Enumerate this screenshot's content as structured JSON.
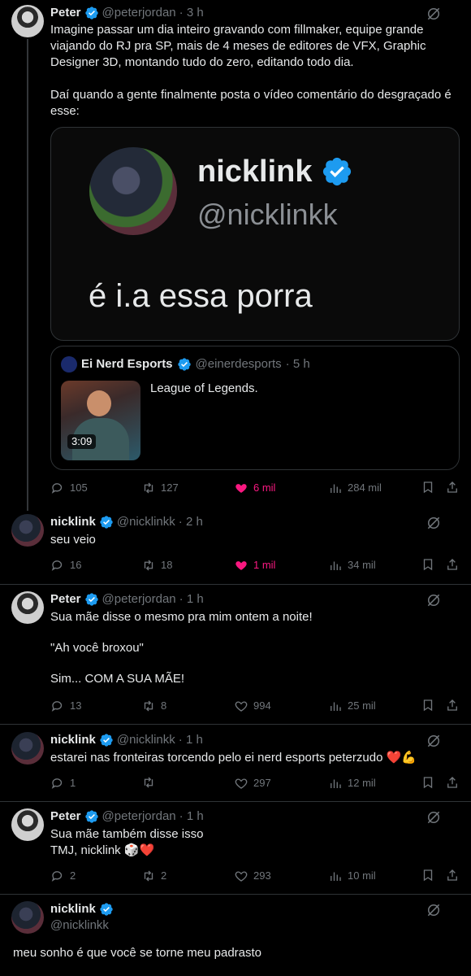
{
  "main_tweet": {
    "name": "Peter",
    "handle": "@peterjordan",
    "time": "· 3 h",
    "text": "Imagine passar um dia inteiro gravando com fillmaker, equipe grande viajando do RJ pra SP, mais de 4 meses de editores de VFX, Graphic Designer 3D, montando tudo do zero, editando todo dia.\n\nDaí quando a gente finalmente posta o vídeo comentário do desgraçado é esse:",
    "media": {
      "name": "nicklink",
      "handle": "@nicklinkk",
      "caption": "é i.a essa porra"
    },
    "quote": {
      "name": "Ei Nerd Esports",
      "handle": "@einerdesports",
      "time": "· 5 h",
      "text": "League of Legends.",
      "duration": "3:09"
    },
    "stats": {
      "replies": "105",
      "retweets": "127",
      "likes": "6 mil",
      "views": "284 mil"
    }
  },
  "replies": [
    {
      "name": "nicklink",
      "handle": "@nicklinkk",
      "time": "· 2 h",
      "text": "seu veio",
      "stats": {
        "replies": "16",
        "retweets": "18",
        "likes": "1 mil",
        "views": "34 mil"
      }
    },
    {
      "name": "Peter",
      "handle": "@peterjordan",
      "time": "· 1 h",
      "text": "Sua mãe disse o mesmo pra mim ontem a noite!\n\n\"Ah você broxou\"\n\nSim... COM A SUA MÃE!",
      "stats": {
        "replies": "13",
        "retweets": "8",
        "likes": "994",
        "views": "25 mil"
      }
    },
    {
      "name": "nicklink",
      "handle": "@nicklinkk",
      "time": "· 1 h",
      "text": "estarei nas fronteiras torcendo pelo ei nerd esports peterzudo ❤️💪",
      "stats": {
        "replies": "1",
        "retweets": "",
        "likes": "297",
        "views": "12 mil"
      }
    },
    {
      "name": "Peter",
      "handle": "@peterjordan",
      "time": "· 1 h",
      "text": "Sua mãe também disse isso\nTMJ, nicklink 🎲❤️",
      "stats": {
        "replies": "2",
        "retweets": "2",
        "likes": "293",
        "views": "10 mil"
      }
    }
  ],
  "focus_tweet": {
    "name": "nicklink",
    "handle": "@nicklinkk",
    "text": "meu sonho é que você se torne meu padrasto"
  },
  "colors": {
    "bg": "#000000",
    "text": "#e7e9ea",
    "muted": "#71767b",
    "like": "#f91880",
    "verified": "#1d9bf0",
    "border": "#2f3336"
  }
}
